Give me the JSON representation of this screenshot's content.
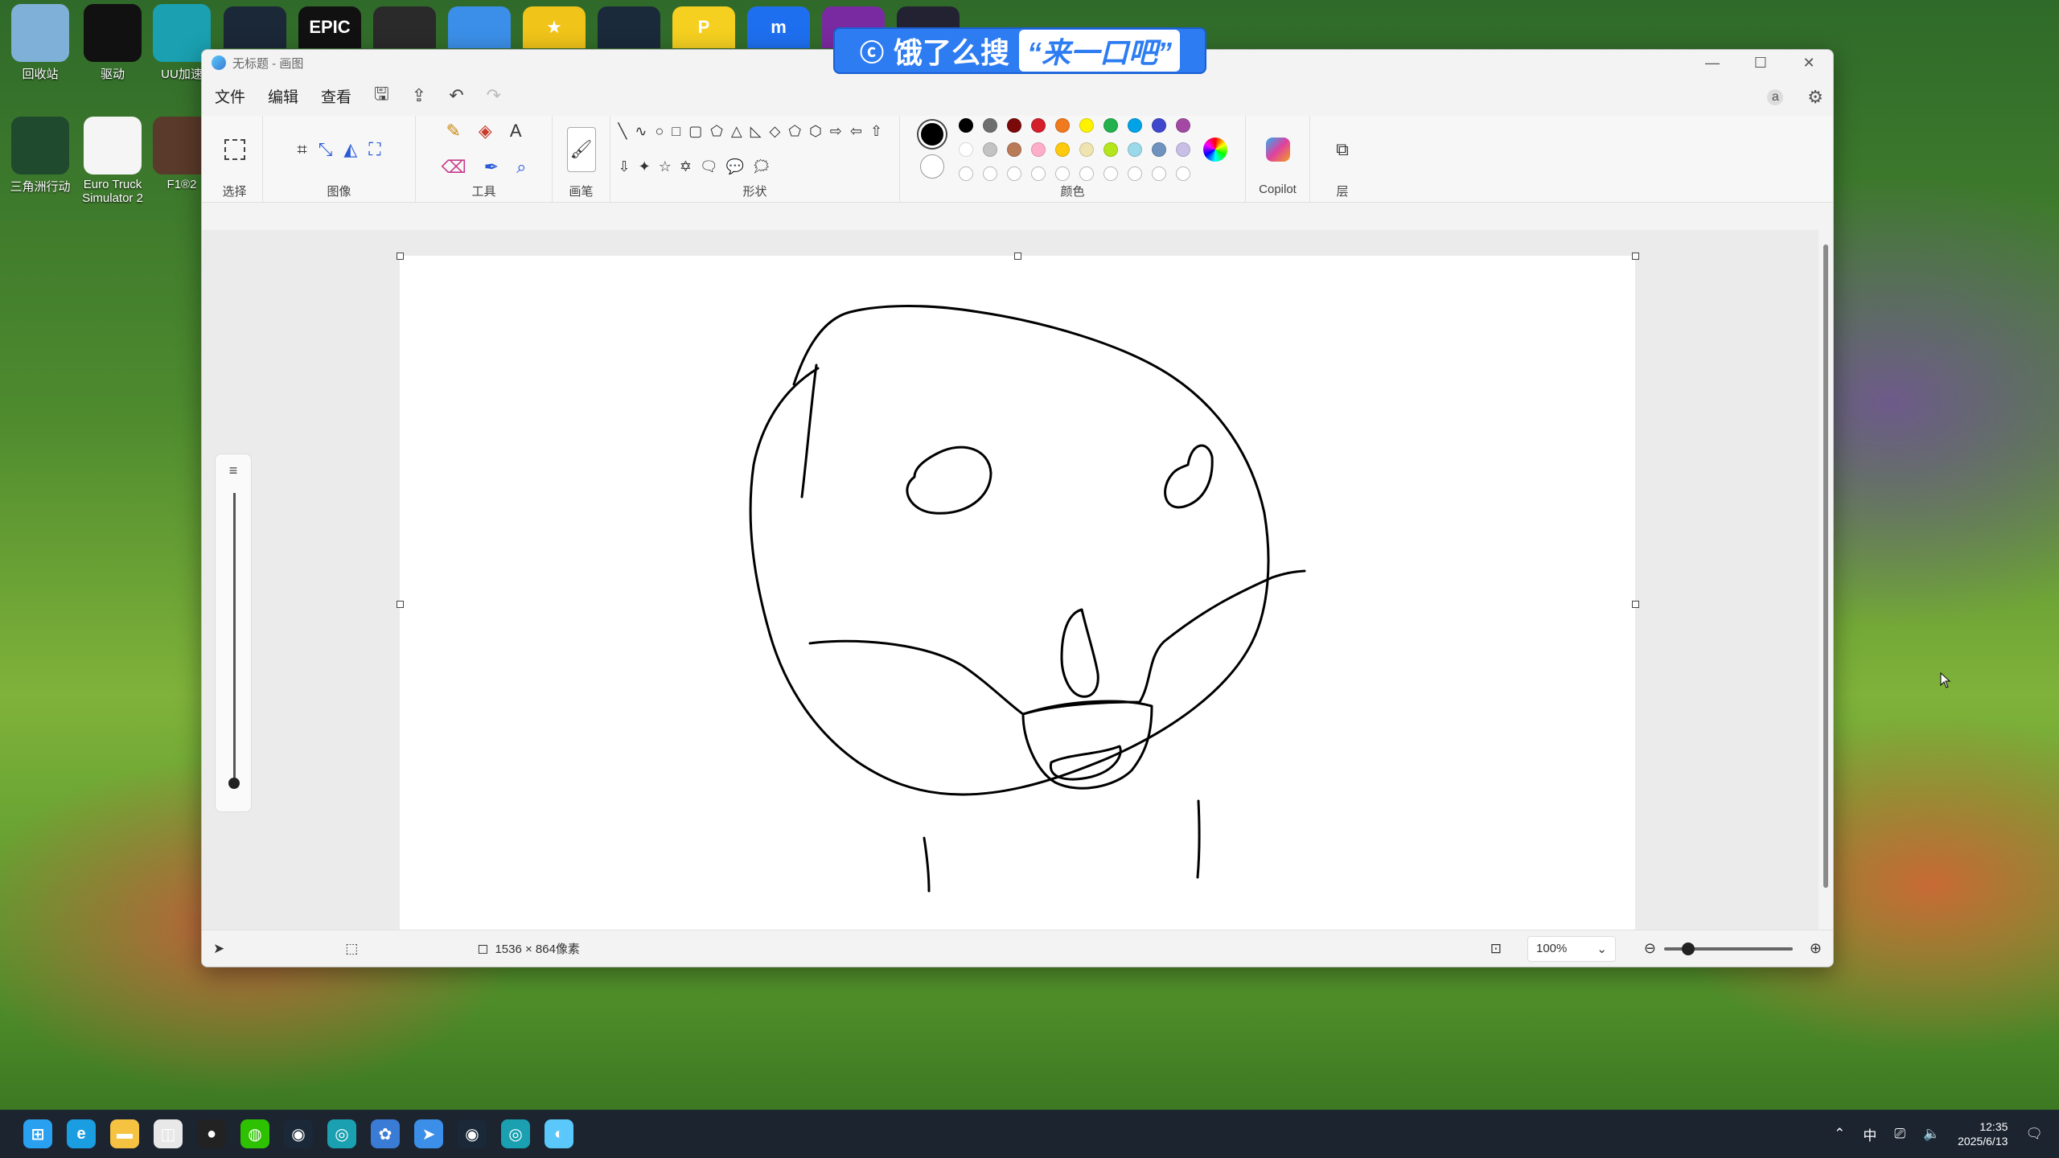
{
  "desktop": {
    "icons": [
      {
        "label": "回收站",
        "icon": "recycle-bin-icon",
        "color": "#7fb0d8"
      },
      {
        "label": "驱动",
        "icon": "driver-icon",
        "color": "#111111"
      },
      {
        "label": "UU加速",
        "icon": "uu-icon",
        "color": "#1aa0b0"
      },
      {
        "label": "三角洲行动",
        "icon": "delta-force-icon",
        "color": "#1f4a2e"
      },
      {
        "label": "Euro Truck Simulator 2",
        "icon": "file-icon",
        "color": "#f5f5f5"
      },
      {
        "label": "F1®2",
        "icon": "f1-icon",
        "color": "#5a3a2a"
      }
    ],
    "top_icons": [
      {
        "name": "steam-icon",
        "color": "#1b2838",
        "text": ""
      },
      {
        "name": "epic-games-icon",
        "color": "#111111",
        "text": "EPIC"
      },
      {
        "name": "app-yellow-icon",
        "color": "#2a2a2a",
        "text": ""
      },
      {
        "name": "bird-icon",
        "color": "#3b8fe8",
        "text": ""
      },
      {
        "name": "star-icon",
        "color": "#f0c419",
        "text": "★"
      },
      {
        "name": "wukong-icon",
        "color": "#1a2a3a",
        "text": ""
      },
      {
        "name": "parsec-icon",
        "color": "#f5d020",
        "text": "P"
      },
      {
        "name": "blue-m-icon",
        "color": "#1e6ff0",
        "text": "m"
      },
      {
        "name": "purple-circle-icon",
        "color": "#7a2aa0",
        "text": ""
      },
      {
        "name": "dark-app-icon",
        "color": "#223",
        "text": ""
      }
    ]
  },
  "banner": {
    "prefix": "饿了么搜",
    "quote": "“来一口吧”"
  },
  "window": {
    "title": "无标题 - 画图",
    "menu": [
      "文件",
      "编辑",
      "查看"
    ],
    "ribbon": {
      "groups": [
        "选择",
        "图像",
        "工具",
        "画笔",
        "形状",
        "颜色",
        "Copilot",
        "层"
      ],
      "colors_row1": [
        "#000000",
        "#6e6e6e",
        "#7a0a0a",
        "#d21f2a",
        "#f07a1e",
        "#fff200",
        "#22b14c",
        "#00a2e8",
        "#3f48cc",
        "#a349a4"
      ],
      "colors_row2": [
        "#ffffff",
        "#c3c3c3",
        "#b97a57",
        "#ffaec9",
        "#ffc90e",
        "#efe4b0",
        "#b5e61d",
        "#99d9ea",
        "#7092be",
        "#c8bfe7"
      ],
      "current_primary": "#000000",
      "current_secondary": "#ffffff"
    },
    "status": {
      "canvas_size": "1536 × 864像素",
      "zoom": "100%"
    }
  },
  "taskbar": {
    "apps": [
      {
        "name": "start-icon",
        "color": "#2aa0f0",
        "glyph": "⊞"
      },
      {
        "name": "edge-icon",
        "color": "#1b9de2",
        "glyph": "e"
      },
      {
        "name": "file-explorer-icon",
        "color": "#f5c242",
        "glyph": "▬"
      },
      {
        "name": "store-icon",
        "color": "#e8e8e8",
        "glyph": "◫"
      },
      {
        "name": "qq-icon",
        "color": "#222",
        "glyph": "●"
      },
      {
        "name": "wechat-icon",
        "color": "#2dc100",
        "glyph": "◍"
      },
      {
        "name": "steam-tb-icon",
        "color": "#1b2838",
        "glyph": "◉"
      },
      {
        "name": "uu-tb-icon",
        "color": "#1aa0b0",
        "glyph": "◎"
      },
      {
        "name": "settings-tb-icon",
        "color": "#3a7bd5",
        "glyph": "✿"
      },
      {
        "name": "bird-tb-icon",
        "color": "#3b8fe8",
        "glyph": "➤"
      },
      {
        "name": "steam2-tb-icon",
        "color": "#1b2838",
        "glyph": "◉"
      },
      {
        "name": "uu2-tb-icon",
        "color": "#1aa0b0",
        "glyph": "◎"
      },
      {
        "name": "paint-tb-icon",
        "color": "#5ac8fa",
        "glyph": "◐"
      }
    ],
    "ime": "中",
    "time": "12:35",
    "date": "2025/6/13"
  }
}
